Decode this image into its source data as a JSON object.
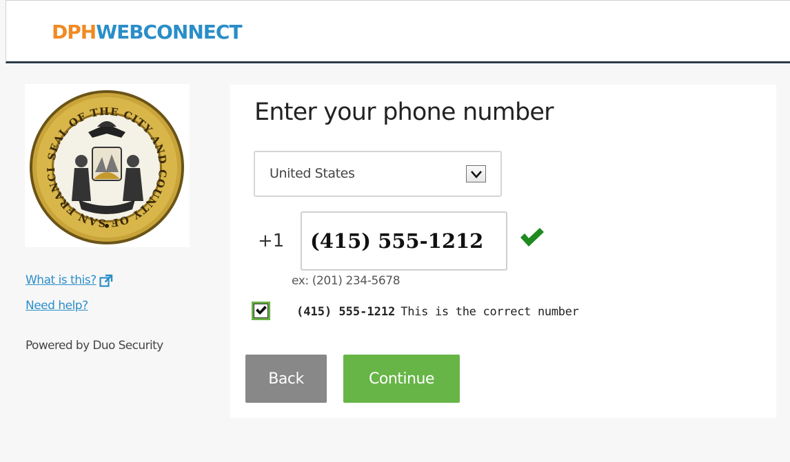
{
  "header": {
    "brand_part1": "DPH",
    "brand_part2": "WEBCONNECT"
  },
  "sidebar": {
    "seal_text": "SEAL OF THE CITY AND COUNTY OF SAN FRANCISCO",
    "what_is_this": "What is this?",
    "need_help": "Need help?",
    "powered_by": "Powered by Duo Security"
  },
  "main": {
    "title": "Enter your phone number",
    "country": {
      "selected": "United States"
    },
    "phone": {
      "prefix": "+1",
      "value": "(415) 555-1212",
      "example": "ex: (201) 234-5678",
      "valid": true
    },
    "confirm": {
      "checked": true,
      "number": "(415) 555-1212",
      "text": "This is the correct number"
    },
    "buttons": {
      "back": "Back",
      "continue": "Continue"
    }
  },
  "colors": {
    "brand_orange": "#f08a24",
    "brand_blue": "#2a8ec8",
    "continue_green": "#67b547",
    "back_gray": "#888888",
    "check_green": "#1f8a1f"
  }
}
